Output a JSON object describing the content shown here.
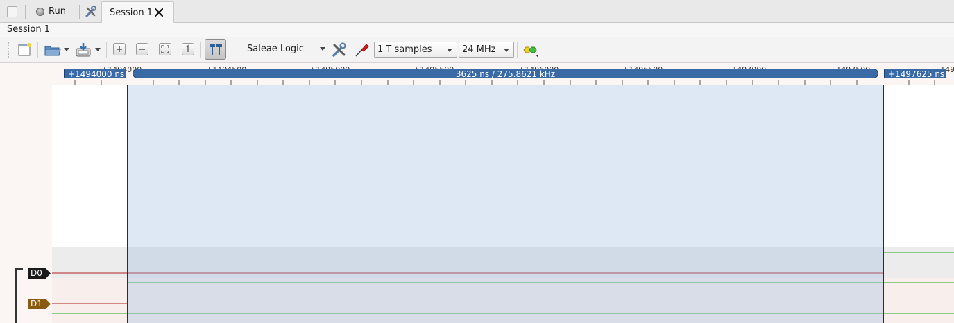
{
  "tabs": {
    "run_label": "Run",
    "session_label": "Session 1"
  },
  "session_title": "Session 1",
  "toolbar": {
    "device_name": "Saleae Logic",
    "samples_value": "1 T samples",
    "rate_value": "24 MHz"
  },
  "ruler": {
    "ticks": [
      "+1494000",
      "+1494500",
      "+1495000",
      "+1495500",
      "+1496000",
      "+1496500",
      "+1497000",
      "+1497500",
      "+149"
    ],
    "start_marker": "+1494000 ns",
    "end_marker": "+1497625 ns",
    "measurement": "3625 ns / 275.8621 kHz"
  },
  "channels": [
    {
      "label": "D0",
      "color": "#1a1a1a"
    },
    {
      "label": "D1",
      "color": "#8a5a10"
    }
  ],
  "colors": {
    "selection_border": "#1b2f55",
    "pill": "#3a6aa6",
    "trace_low": "#b02020",
    "trace_high": "#22aa22"
  }
}
